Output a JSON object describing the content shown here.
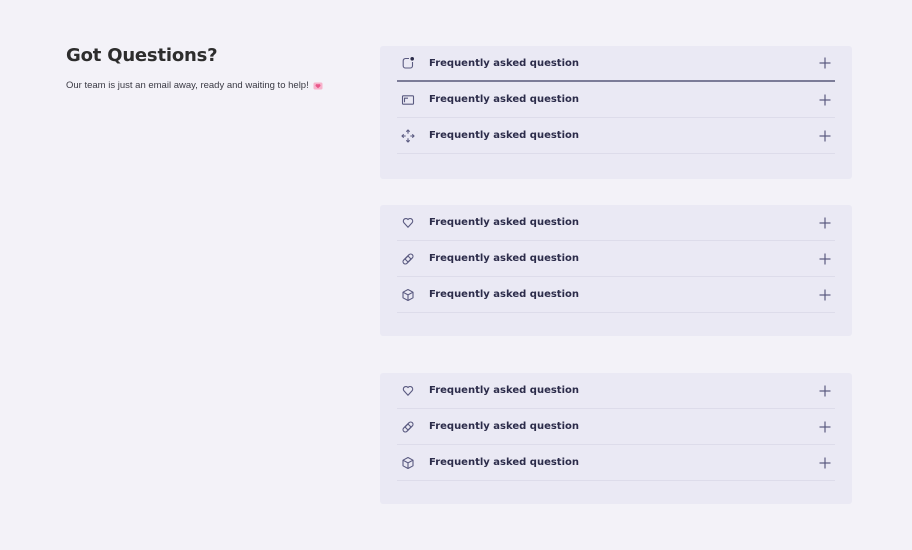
{
  "intro": {
    "title": "Got Questions?",
    "subtitle": "Our team is just an email away, ready and waiting to help!"
  },
  "colors": {
    "background": "#f3f2f8",
    "panel": "#eae9f4",
    "icon_stroke": "#5a5a80",
    "accent_heart": "#e8568a"
  },
  "panels": [
    {
      "items": [
        {
          "label": "Frequently asked question",
          "icon": "notification-icon",
          "active": true
        },
        {
          "label": "Frequently asked question",
          "icon": "window-icon",
          "active": false
        },
        {
          "label": "Frequently asked question",
          "icon": "move-arrows-icon",
          "active": false
        }
      ]
    },
    {
      "items": [
        {
          "label": "Frequently asked question",
          "icon": "heart-icon",
          "active": false
        },
        {
          "label": "Frequently asked question",
          "icon": "bandage-icon",
          "active": false
        },
        {
          "label": "Frequently asked question",
          "icon": "cube-icon",
          "active": false
        }
      ]
    },
    {
      "items": [
        {
          "label": "Frequently asked question",
          "icon": "heart-icon",
          "active": false
        },
        {
          "label": "Frequently asked question",
          "icon": "bandage-icon",
          "active": false
        },
        {
          "label": "Frequently asked question",
          "icon": "cube-icon",
          "active": false
        }
      ]
    }
  ]
}
